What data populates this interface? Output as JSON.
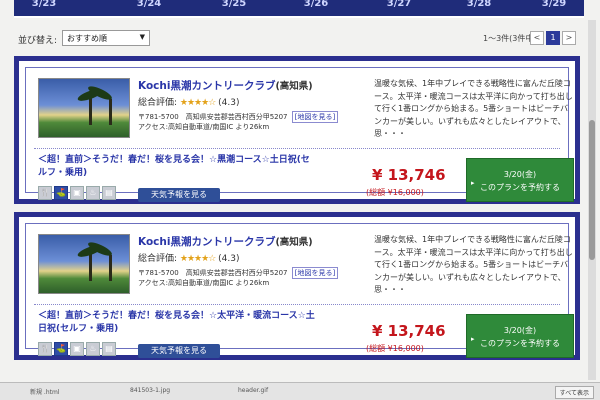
{
  "date_bar": {
    "dates": [
      "3/23",
      "3/24",
      "3/25",
      "3/26",
      "3/27",
      "3/28",
      "3/29"
    ]
  },
  "toolbar": {
    "sort_label": "並び替え:",
    "sort_value": "おすすめ順",
    "result_count": "1〜3件(3件中)",
    "prev": "<",
    "current_page": "1",
    "next": ">"
  },
  "cards": [
    {
      "title": "Kochi黒潮カントリークラブ",
      "pref": "(高知県)",
      "rating_label": "総合評価:",
      "stars": "★★★★☆",
      "rating_value": "(4.3)",
      "address": "〒781-5700　高知県安芸郡芸西村西分甲5207",
      "map_link": "[地図を見る]",
      "access": "アクセス:高知自動車道/南国IC より26km",
      "description": "温暖な気候、1年中プレイできる戦略性に富んだ丘陵コース。太平洋・暖流コースは太平洋に向かって打ち出して行く1番ロングから始まる。5番ショートはビーチバンカーが美しい。いずれも広々としたレイアウトで、思・・・",
      "plan": "＜超！直前＞そうだ！春だ！桜を見る会！☆黒潮コース☆土日祝(セルフ・乗用)",
      "weather_button": "天気予報を見る",
      "price": "¥ 13,746",
      "price_total": "(総額 ¥16,000)",
      "book_date": "3/20(金)",
      "book_label": "このプランを予約する"
    },
    {
      "title": "Kochi黒潮カントリークラブ",
      "pref": "(高知県)",
      "rating_label": "総合評価:",
      "stars": "★★★★☆",
      "rating_value": "(4.3)",
      "address": "〒781-5700　高知県安芸郡芸西村西分甲5207",
      "map_link": "[地図を見る]",
      "access": "アクセス:高知自動車道/南国IC より26km",
      "description": "温暖な気候、1年中プレイできる戦略性に富んだ丘陵コース。太平洋・暖流コースは太平洋に向かって打ち出して行く1番ロングから始まる。5番ショートはビーチバンカーが美しい。いずれも広々としたレイアウトで、思・・・",
      "plan": "＜超！直前＞そうだ！春だ！桜を見る会！☆太平洋・暖流コース☆土日祝(セルフ・乗用)",
      "weather_button": "天気予報を見る",
      "price": "¥ 13,746",
      "price_total": "(総額 ¥16,000)",
      "book_date": "3/20(金)",
      "book_label": "このプランを予約する"
    }
  ],
  "feature_icons": [
    "restaurant-icon",
    "golf-course-icon",
    "cart-icon",
    "shower-icon",
    "shop-icon"
  ],
  "taskbar": {
    "items": [
      "新規 .html",
      "841503-1.jpg",
      "header.gif"
    ],
    "show_all": "すべて表示"
  },
  "colors": {
    "accent": "#2b2f8f",
    "price": "#c4161c",
    "book": "#2f8a3a"
  }
}
